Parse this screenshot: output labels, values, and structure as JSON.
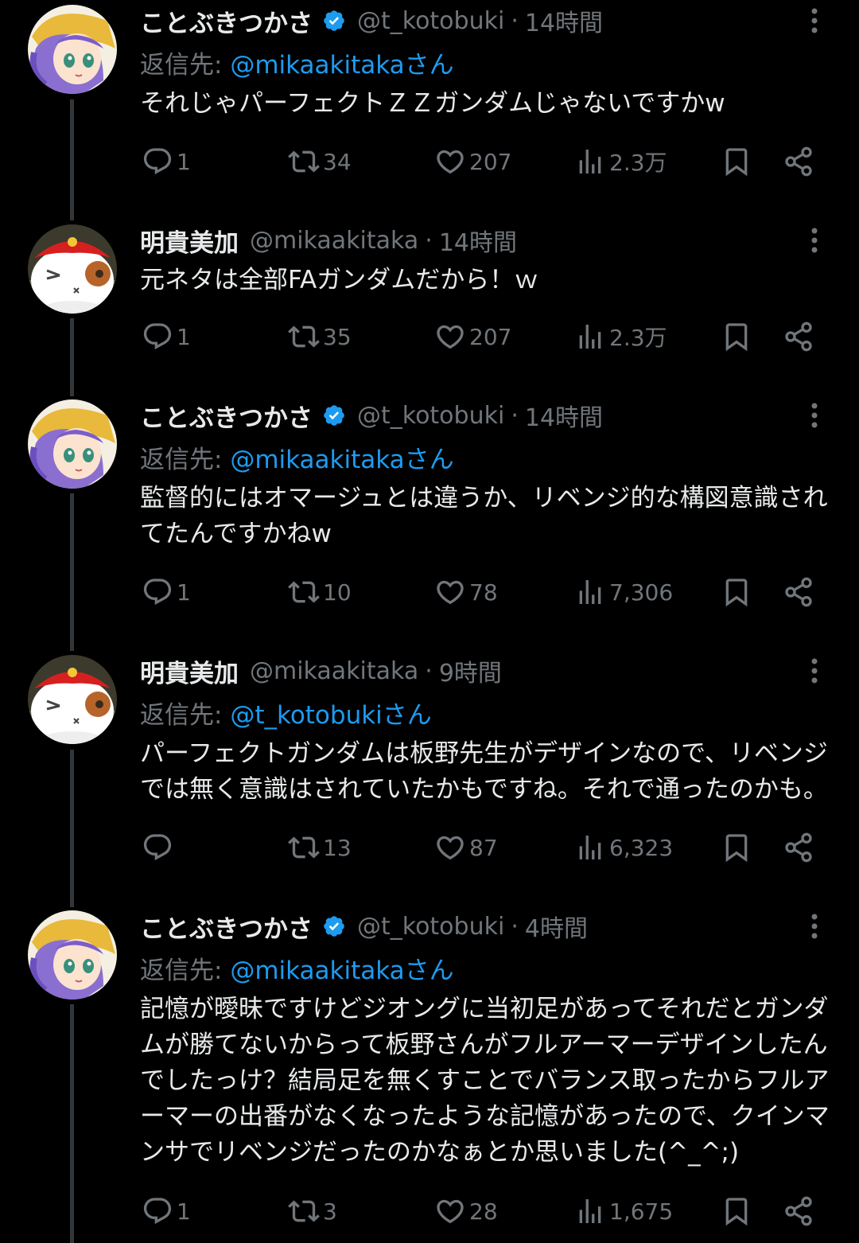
{
  "tweets": [
    {
      "name": "ことぶきつかさ",
      "verified": true,
      "handle": "@t_kotobuki",
      "time": "14時間",
      "reply_prefix": "返信先:",
      "reply_mention": "@mikaakitakaさん",
      "text": "それじゃパーフェクトＺＺガンダムじゃないですかw",
      "replies": "1",
      "retweets": "34",
      "likes": "207",
      "views": "2.3万",
      "avatar": "avatar-kotobuki"
    },
    {
      "name": "明貴美加",
      "verified": false,
      "handle": "@mikaakitaka",
      "time": "14時間",
      "reply_prefix": "",
      "reply_mention": "",
      "text": "元ネタは全部FAガンダムだから！ｗ",
      "replies": "1",
      "retweets": "35",
      "likes": "207",
      "views": "2.3万",
      "avatar": "avatar-mika"
    },
    {
      "name": "ことぶきつかさ",
      "verified": true,
      "handle": "@t_kotobuki",
      "time": "14時間",
      "reply_prefix": "返信先:",
      "reply_mention": "@mikaakitakaさん",
      "text": "監督的にはオマージュとは違うか、リベンジ的な構図意識されてたんですかねw",
      "replies": "1",
      "retweets": "10",
      "likes": "78",
      "views": "7,306",
      "avatar": "avatar-kotobuki"
    },
    {
      "name": "明貴美加",
      "verified": false,
      "handle": "@mikaakitaka",
      "time": "9時間",
      "reply_prefix": "返信先:",
      "reply_mention": "@t_kotobukiさん",
      "text": "パーフェクトガンダムは板野先生がデザインなので、リベンジでは無く意識はされていたかもですね。それで通ったのかも。",
      "replies": "",
      "retweets": "13",
      "likes": "87",
      "views": "6,323",
      "avatar": "avatar-mika"
    },
    {
      "name": "ことぶきつかさ",
      "verified": true,
      "handle": "@t_kotobuki",
      "time": "4時間",
      "reply_prefix": "返信先:",
      "reply_mention": "@mikaakitakaさん",
      "text": "記憶が曖昧ですけどジオングに当初足があってそれだとガンダムが勝てないからって板野さんがフルアーマーデザインしたんでしたっけ？結局足を無くすことでバランス取ったからフルアーマーの出番がなくなったような記憶があったので、クインマンサでリベンジだったのかなぁとか思いました(^_^;)",
      "replies": "1",
      "retweets": "3",
      "likes": "28",
      "views": "1,675",
      "avatar": "avatar-kotobuki"
    }
  ],
  "colors": {
    "background": "#000000",
    "text": "#e7e9ea",
    "muted": "#71767b",
    "link": "#1d9bf0",
    "verified": "#1d9bf0"
  }
}
